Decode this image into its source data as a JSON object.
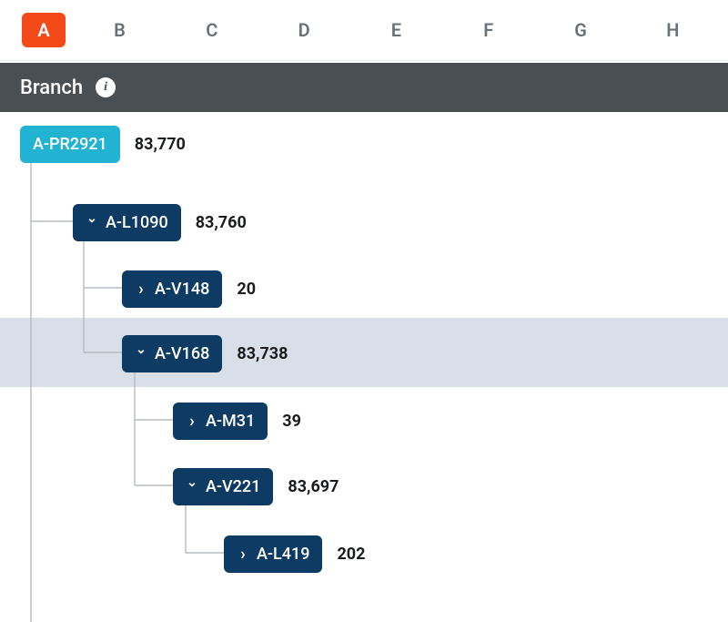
{
  "tabs": {
    "items": [
      "A",
      "B",
      "C",
      "D",
      "E",
      "F",
      "G",
      "H"
    ],
    "active_index": 0
  },
  "section": {
    "title": "Branch"
  },
  "tree": {
    "root": {
      "label": "A-PR2921",
      "count": "83,770"
    },
    "n1": {
      "label": "A-L1090",
      "count": "83,760"
    },
    "n1a": {
      "label": "A-V148",
      "count": "20"
    },
    "n1b": {
      "label": "A-V168",
      "count": "83,738"
    },
    "n1b1": {
      "label": "A-M31",
      "count": "39"
    },
    "n1b2": {
      "label": "A-V221",
      "count": "83,697"
    },
    "n1b2a": {
      "label": "A-L419",
      "count": "202"
    }
  },
  "colors": {
    "tab_active_bg": "#f44a1a",
    "header_bg": "#4a4f53",
    "root_pill_bg": "#22b3d3",
    "node_pill_bg": "#0d3b63",
    "highlight_bg": "#c4cedd"
  }
}
